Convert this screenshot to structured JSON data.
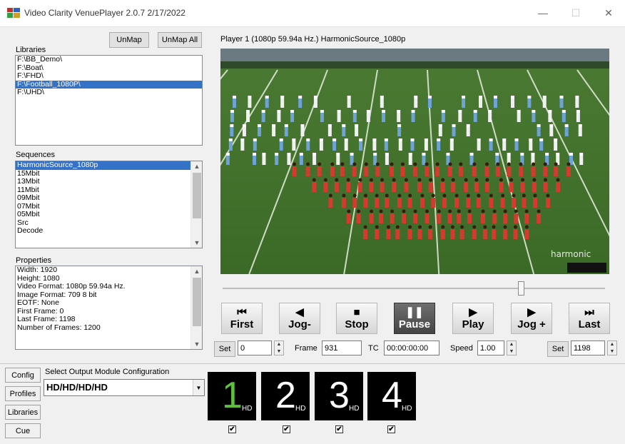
{
  "window": {
    "title": "Video Clarity VenuePlayer 2.0.7  2/17/2022",
    "minimize": "—",
    "maximize": "☐",
    "close": "✕"
  },
  "libraries": {
    "label": "Libraries",
    "unmap": "UnMap",
    "unmap_all": "UnMap All",
    "items": [
      "F:\\BB_Demo\\",
      "F:\\Boat\\",
      "F:\\FHD\\",
      "F:\\Football_1080P\\",
      "F:\\UHD\\"
    ],
    "selected": "F:\\Football_1080P\\"
  },
  "sequences": {
    "label": "Sequences",
    "items": [
      "HarmonicSource_1080p",
      "15Mbit",
      "13Mbit",
      "11Mbit",
      "09Mbit",
      "07Mbit",
      "05Mbit",
      "Src",
      "Decode"
    ],
    "selected": "HarmonicSource_1080p"
  },
  "properties": {
    "label": "Properties",
    "items": [
      "Width: 1920",
      "Height: 1080",
      "Video Format: 1080p 59.94a Hz.",
      "Image Format: 709 8 bit",
      "EOTF: None",
      "First Frame: 0",
      "Last Frame: 1198",
      "Number of Frames: 1200"
    ]
  },
  "player": {
    "header": "Player 1  (1080p 59.94a Hz.) HarmonicSource_1080p",
    "watermark": "harmonic",
    "position_fraction": 0.78
  },
  "transport": {
    "first": "First",
    "jog_back": "Jog-",
    "stop": "Stop",
    "pause": "Pause",
    "play": "Play",
    "jog_fwd": "Jog +",
    "last": "Last",
    "icons": {
      "first": "⏮",
      "jog_back": "◀",
      "stop": "■",
      "pause": "❚❚",
      "play": "▶",
      "jog_fwd": "▶",
      "last": "⏭"
    },
    "active": "pause"
  },
  "controls": {
    "set_left_label": "Set",
    "set_left_value": "0",
    "frame_label": "Frame",
    "frame_value": "931",
    "tc_label": "TC",
    "tc_value": "00:00:00:00",
    "speed_label": "Speed",
    "speed_value": "1.00",
    "set_right_label": "Set",
    "set_right_value": "1198"
  },
  "sidebar": {
    "config": "Config",
    "profiles": "Profiles",
    "libraries": "Libraries",
    "cue": "Cue"
  },
  "output": {
    "label": "Select Output Module Configuration",
    "selected": "HD/HD/HD/HD",
    "modules": [
      {
        "num": "1",
        "tag": "HD",
        "color": "#5fbf3f",
        "checked": "✔"
      },
      {
        "num": "2",
        "tag": "HD",
        "color": "#ffffff",
        "checked": "✔"
      },
      {
        "num": "3",
        "tag": "HD",
        "color": "#ffffff",
        "checked": "✔"
      },
      {
        "num": "4",
        "tag": "HD",
        "color": "#ffffff",
        "checked": "✔"
      }
    ]
  }
}
